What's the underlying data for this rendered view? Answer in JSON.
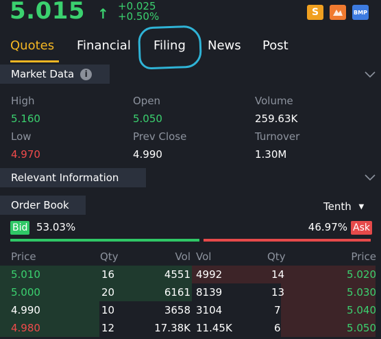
{
  "quote": {
    "price": "5.015",
    "arrow": "↑",
    "change": "+0.025",
    "change_pct": "+0.50%"
  },
  "badges": {
    "s": "S",
    "h": "",
    "bmp": "BMP"
  },
  "tabs": [
    "Quotes",
    "Financial",
    "Filing",
    "News",
    "Post"
  ],
  "active_tab": "Quotes",
  "market_data": {
    "title": "Market Data",
    "info_icon": "i",
    "high_label": "High",
    "high": "5.160",
    "open_label": "Open",
    "open": "5.050",
    "volume_label": "Volume",
    "volume": "259.63K",
    "low_label": "Low",
    "low": "4.970",
    "prev_close_label": "Prev Close",
    "prev_close": "4.990",
    "turnover_label": "Turnover",
    "turnover": "1.30M"
  },
  "relevant": {
    "title": "Relevant Information"
  },
  "order_book": {
    "title": "Order Book",
    "depth": "Tenth",
    "depth_caret": "▼",
    "bid_label": "Bid",
    "bid_pct": "53.03%",
    "ask_label": "Ask",
    "ask_pct": "46.97%",
    "bid_ratio": 0.5303,
    "headers": {
      "bid_price": "Price",
      "bid_qty": "Qty",
      "bid_vol": "Vol",
      "ask_vol": "Vol",
      "ask_qty": "Qty",
      "ask_price": "Price"
    },
    "rows": [
      {
        "bid_price": "5.010",
        "bid_qty": "16",
        "bid_vol": "4551",
        "ask_vol": "4992",
        "ask_qty": "14",
        "ask_price": "5.020"
      },
      {
        "bid_price": "5.000",
        "bid_qty": "20",
        "bid_vol": "6161",
        "ask_vol": "8139",
        "ask_qty": "13",
        "ask_price": "5.030"
      },
      {
        "bid_price": "4.990",
        "bid_qty": "10",
        "bid_vol": "3658",
        "ask_vol": "3104",
        "ask_qty": "7",
        "ask_price": "5.040"
      },
      {
        "bid_price": "4.980",
        "bid_qty": "12",
        "bid_vol": "17.38K",
        "ask_vol": "11.45K",
        "ask_qty": "6",
        "ask_price": "5.050"
      }
    ]
  },
  "colors": {
    "up": "#3bd16f",
    "down": "#f04b4b",
    "accent": "#f5b723",
    "annotation": "#2fb3d6"
  }
}
